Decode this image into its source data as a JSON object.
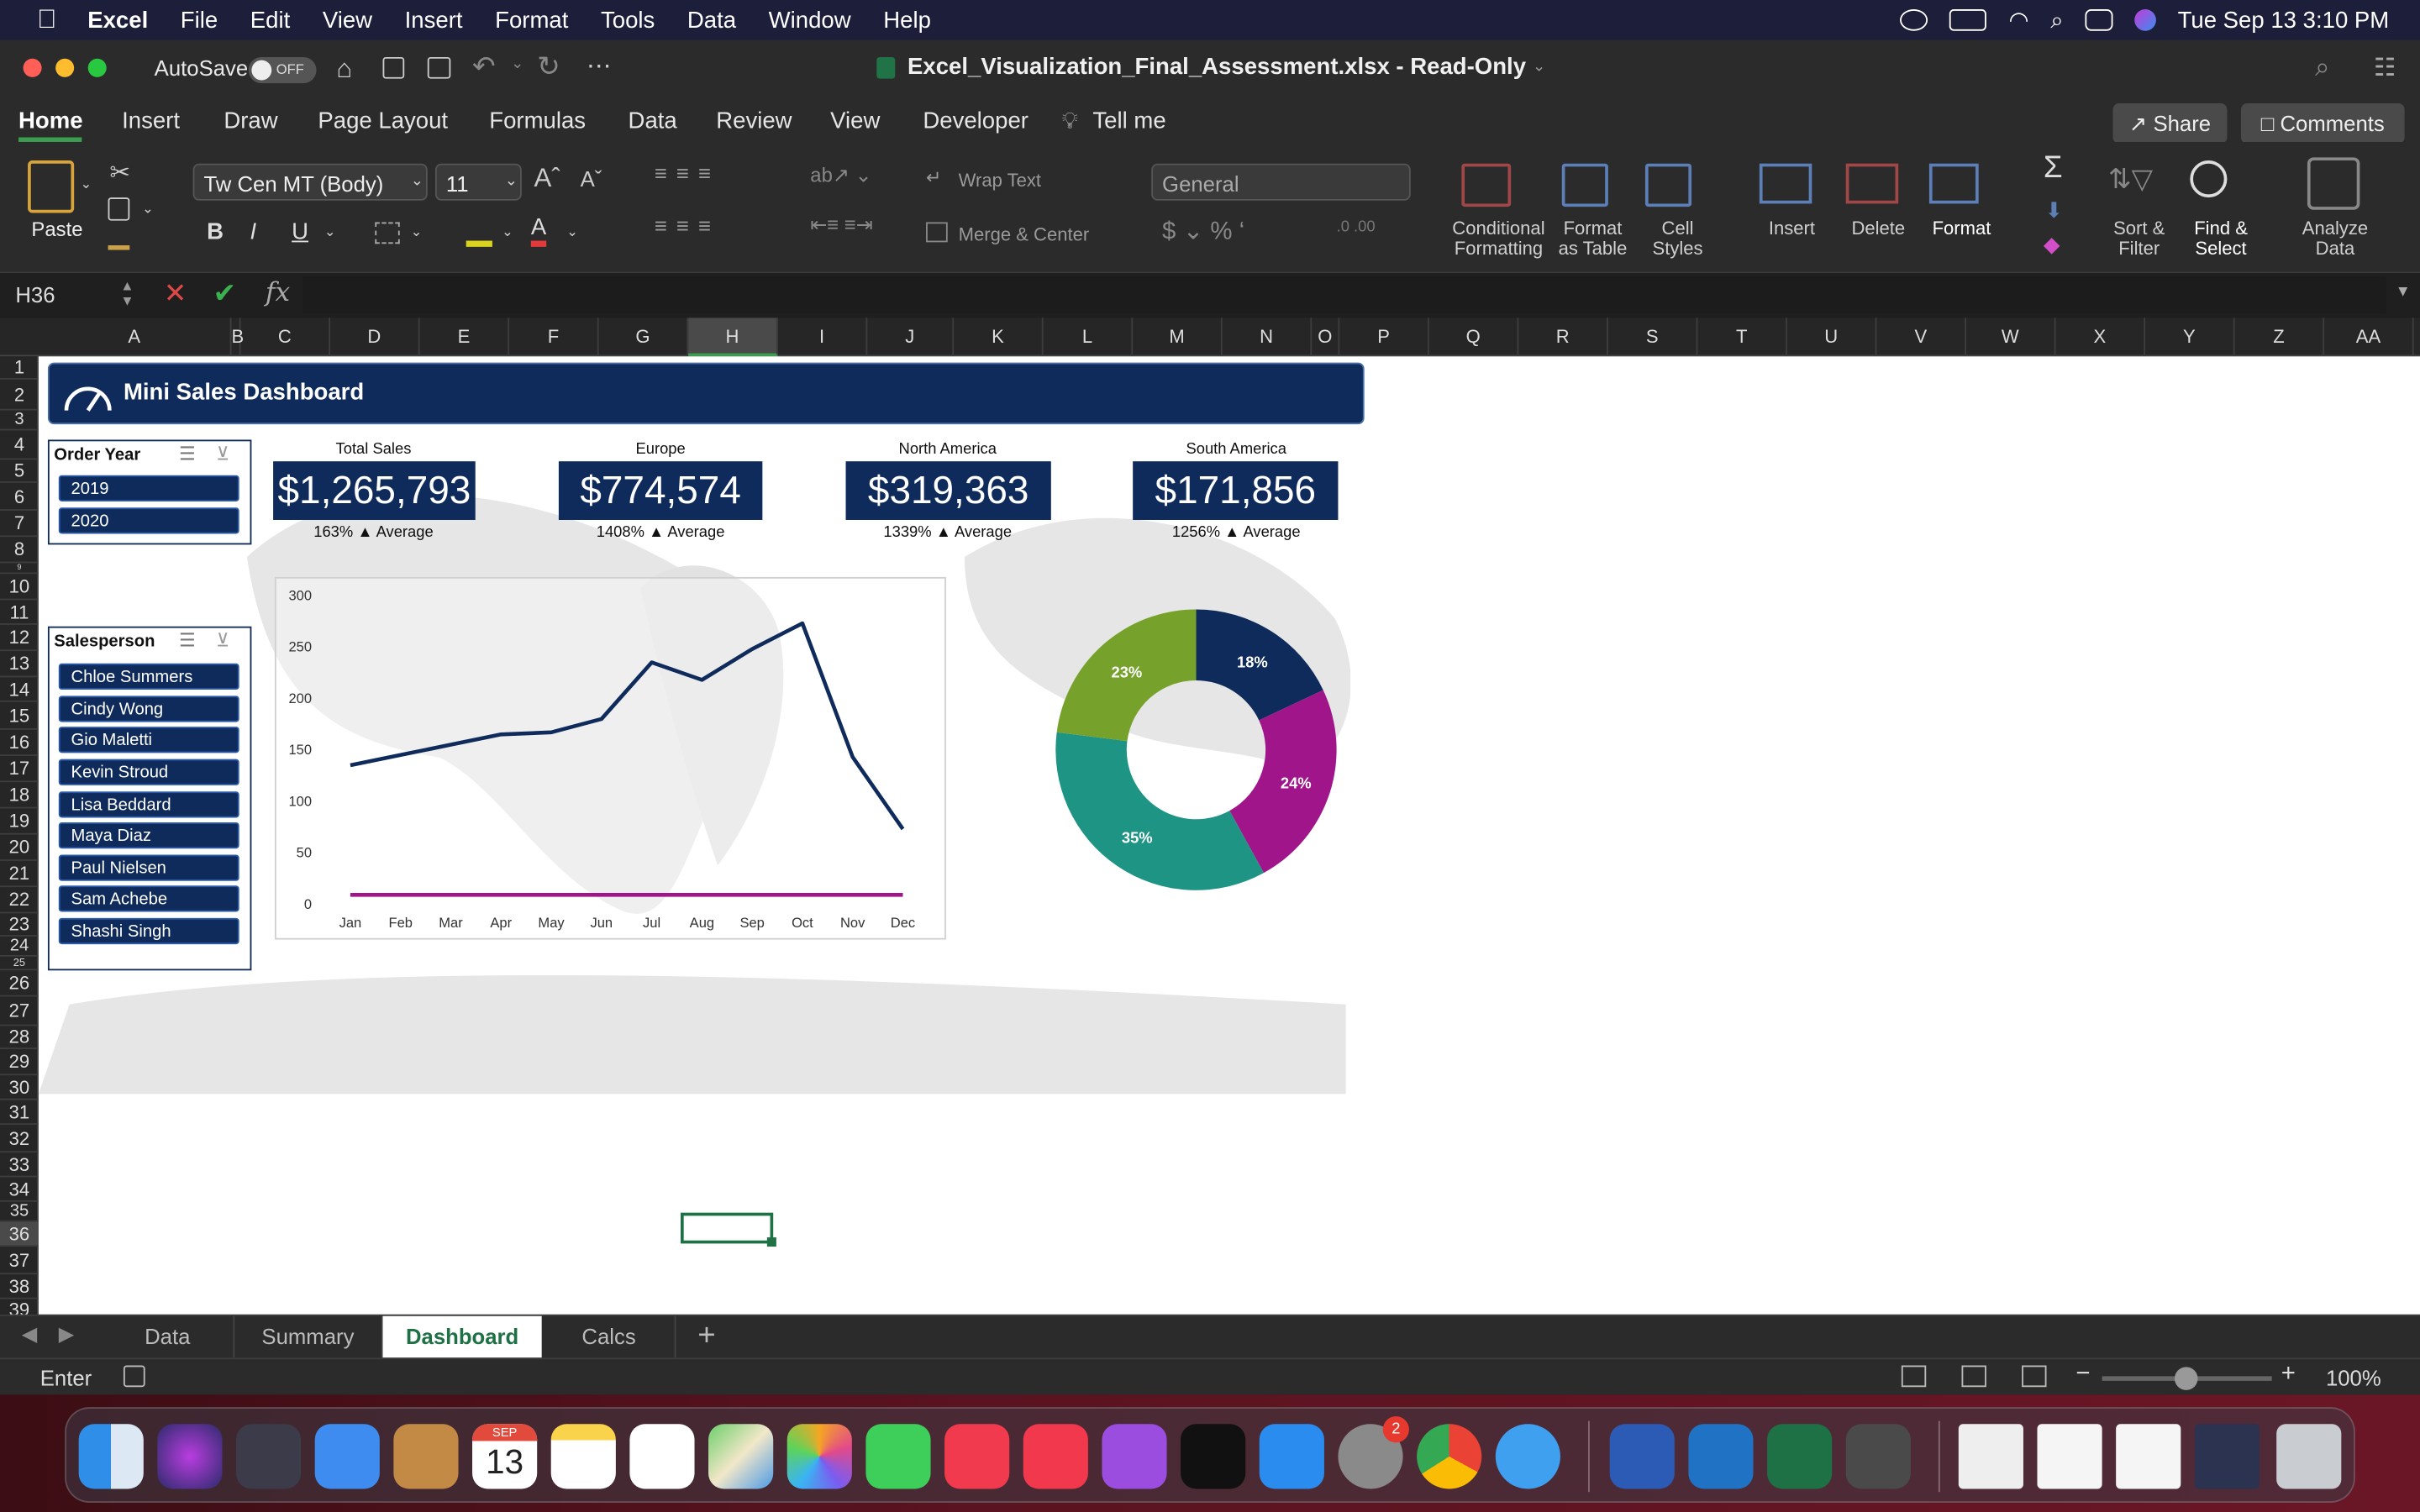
{
  "menubar": {
    "apple": "",
    "app": "Excel",
    "items": [
      "File",
      "Edit",
      "View",
      "Insert",
      "Format",
      "Tools",
      "Data",
      "Window",
      "Help"
    ],
    "clock": "Tue Sep 13  3:10 PM"
  },
  "titlebar": {
    "autosave": "AutoSave",
    "autosave_state": "OFF",
    "filename": "Excel_Visualization_Final_Assessment.xlsx  -  Read-Only"
  },
  "ribbon_tabs": [
    "Home",
    "Insert",
    "Draw",
    "Page Layout",
    "Formulas",
    "Data",
    "Review",
    "View",
    "Developer",
    "Tell me"
  ],
  "share": "Share",
  "comments": "Comments",
  "ribbon": {
    "paste": "Paste",
    "font": "Tw Cen MT (Body)",
    "size": "11",
    "bold": "B",
    "italic": "I",
    "underline": "U",
    "wrap": "Wrap Text",
    "merge": "Merge & Center",
    "numfmt": "General",
    "cond": [
      "Conditional",
      "Formatting"
    ],
    "fmt_table": [
      "Format",
      "as Table"
    ],
    "cell_styles": [
      "Cell",
      "Styles"
    ],
    "insert": "Insert",
    "delete": "Delete",
    "format": "Format",
    "sort": [
      "Sort &",
      "Filter"
    ],
    "find": [
      "Find &",
      "Select"
    ],
    "analyze": [
      "Analyze",
      "Data"
    ]
  },
  "formula": {
    "namebox": "H36",
    "fx": "fx",
    "value": ""
  },
  "columns": [
    "A",
    "B",
    "C",
    "D",
    "E",
    "F",
    "G",
    "H",
    "I",
    "J",
    "K",
    "L",
    "M",
    "N",
    "O",
    "P",
    "Q",
    "R",
    "S",
    "T",
    "U",
    "V",
    "W",
    "X",
    "Y",
    "Z",
    "AA"
  ],
  "rows": [
    "1",
    "2",
    "3",
    "4",
    "5",
    "6",
    "7",
    "8",
    "9",
    "10",
    "11",
    "12",
    "13",
    "14",
    "15",
    "16",
    "17",
    "18",
    "19",
    "20",
    "21",
    "22",
    "23",
    "24",
    "25",
    "26",
    "27",
    "28",
    "29",
    "30",
    "31",
    "32",
    "33",
    "34",
    "35",
    "36",
    "37",
    "38",
    "39"
  ],
  "dashboard": {
    "title": "Mini Sales Dashboard",
    "order_year": {
      "header": "Order Year",
      "items": [
        "2019",
        "2020"
      ]
    },
    "salesperson": {
      "header": "Salesperson",
      "items": [
        "Chloe Summers",
        "Cindy Wong",
        "Gio Maletti",
        "Kevin Stroud",
        "Lisa Beddard",
        "Maya Diaz",
        "Paul Nielsen",
        "Sam Achebe",
        "Shashi Singh"
      ]
    },
    "kpis": [
      {
        "label": "Total Sales",
        "value": "$1,265,793",
        "pct": "163%",
        "arrow": "▲",
        "note": "Average"
      },
      {
        "label": "Europe",
        "value": "$774,574",
        "pct": "1408%",
        "arrow": "▲",
        "note": "Average"
      },
      {
        "label": "North America",
        "value": "$319,363",
        "pct": "1339%",
        "arrow": "▲",
        "note": "Average"
      },
      {
        "label": "South America",
        "value": "$171,856",
        "pct": "1256%",
        "arrow": "▲",
        "note": "Average"
      }
    ]
  },
  "chart_data": [
    {
      "type": "line",
      "categories": [
        "Jan",
        "Feb",
        "Mar",
        "Apr",
        "May",
        "Jun",
        "Jul",
        "Aug",
        "Sep",
        "Oct",
        "Nov",
        "Dec"
      ],
      "yticks": [
        "0",
        "50",
        "100",
        "150",
        "200",
        "250",
        "300"
      ],
      "ylim": [
        0,
        300
      ],
      "series": [
        {
          "values": [
            135,
            145,
            155,
            165,
            167,
            180,
            235,
            218,
            248,
            273,
            143,
            73
          ],
          "color": "#0f2b5b"
        },
        {
          "values": [
            9,
            9,
            9,
            9,
            9,
            9,
            9,
            9,
            9,
            9,
            9,
            9
          ],
          "color": "#a0168a"
        }
      ]
    },
    {
      "type": "pie",
      "variant": "donut",
      "slices": [
        {
          "label": "18%",
          "value": 18,
          "color": "#0f2b5b"
        },
        {
          "label": "24%",
          "value": 24,
          "color": "#a0168a"
        },
        {
          "label": "35%",
          "value": 35,
          "color": "#1e9484"
        },
        {
          "label": "23%",
          "value": 23,
          "color": "#76a22b"
        }
      ]
    }
  ],
  "sheet_tabs": [
    "Data",
    "Summary",
    "Dashboard",
    "Calcs"
  ],
  "active_tab": "Dashboard",
  "status": {
    "mode": "Enter",
    "zoom": "100%"
  },
  "dock": {
    "calendar_month": "SEP",
    "calendar_day": "13",
    "badge": "2"
  }
}
